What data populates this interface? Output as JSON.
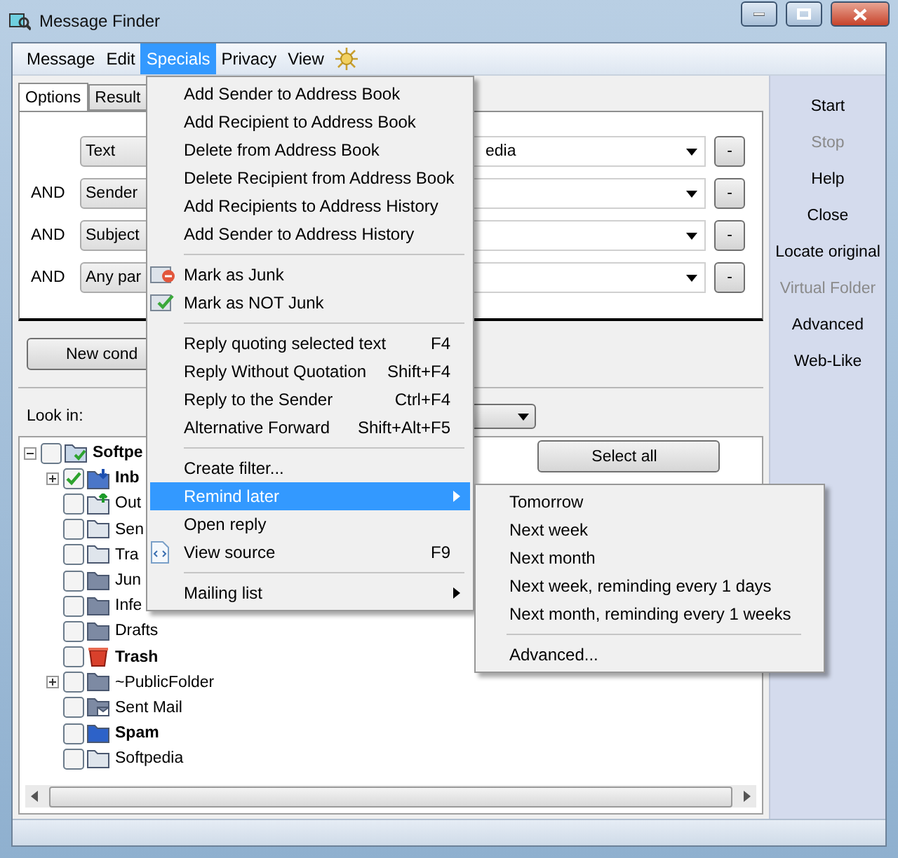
{
  "window": {
    "title": "Message Finder"
  },
  "menubar": [
    {
      "label": "Message",
      "selected": false
    },
    {
      "label": "Edit",
      "selected": false
    },
    {
      "label": "Specials",
      "selected": true
    },
    {
      "label": "Privacy",
      "selected": false
    },
    {
      "label": "View",
      "selected": false
    }
  ],
  "tabs": [
    {
      "label": "Options",
      "selected": true
    },
    {
      "label": "Result",
      "selected": false
    }
  ],
  "conditions": [
    {
      "field": "Text",
      "value": "edia",
      "button": "-"
    },
    {
      "connector": "AND",
      "field": "Sender",
      "button": "-"
    },
    {
      "connector": "AND",
      "field": "Subject",
      "button": "-"
    },
    {
      "connector": "AND",
      "field": "Any par",
      "button": "-"
    }
  ],
  "new_condition_button": "New cond",
  "look_in": {
    "label": "Look in:"
  },
  "select_all_button": "Select all",
  "folders": [
    {
      "label": "Softpe",
      "kind": "account",
      "bold": true,
      "checked": false,
      "expandable": true,
      "expanded": true,
      "children": [
        {
          "label": "Inb",
          "kind": "inbox",
          "bold": true,
          "checked": true,
          "expandable": true,
          "expanded": false
        },
        {
          "label": "Out",
          "kind": "outbox",
          "bold": false,
          "checked": false,
          "expandable": false
        },
        {
          "label": "Sen",
          "kind": "folder",
          "bold": false,
          "checked": false,
          "expandable": false
        },
        {
          "label": "Tra",
          "kind": "folder",
          "bold": false,
          "checked": false,
          "expandable": false
        },
        {
          "label": "Jun",
          "kind": "dark",
          "bold": false,
          "checked": false,
          "expandable": false
        },
        {
          "label": "Infe",
          "kind": "dark",
          "bold": false,
          "checked": false,
          "expandable": false
        },
        {
          "label": "Drafts",
          "kind": "dark",
          "bold": false,
          "checked": false,
          "expandable": false
        },
        {
          "label": "Trash",
          "kind": "trash",
          "bold": true,
          "checked": false,
          "expandable": false
        },
        {
          "label": "~PublicFolder",
          "kind": "dark",
          "bold": false,
          "checked": false,
          "expandable": true,
          "expanded": false
        },
        {
          "label": "Sent Mail",
          "kind": "sent",
          "bold": false,
          "checked": false,
          "expandable": false
        },
        {
          "label": "Spam",
          "kind": "blue",
          "bold": true,
          "checked": false,
          "expandable": false
        },
        {
          "label": "Softpedia",
          "kind": "folder",
          "bold": false,
          "checked": false,
          "expandable": false
        }
      ]
    }
  ],
  "sidebar": [
    {
      "label": "Start",
      "disabled": false
    },
    {
      "label": "Stop",
      "disabled": true
    },
    {
      "label": "Help",
      "disabled": false
    },
    {
      "label": "Close",
      "disabled": false
    },
    {
      "label": "Locate original",
      "disabled": false
    },
    {
      "label": "Virtual Folder",
      "disabled": true
    },
    {
      "label": "Advanced",
      "disabled": false
    },
    {
      "label": "Web-Like",
      "disabled": false
    }
  ],
  "specials_menu": [
    {
      "kind": "item",
      "label": "Add Sender to Address Book",
      "selected": false
    },
    {
      "kind": "item",
      "label": "Add Recipient to Address Book",
      "selected": false
    },
    {
      "kind": "item",
      "label": "Delete from Address Book",
      "selected": false
    },
    {
      "kind": "item",
      "label": "Delete Recipient from Address Book",
      "selected": false
    },
    {
      "kind": "item",
      "label": "Add Recipients to Address History",
      "selected": false
    },
    {
      "kind": "item",
      "label": "Add Sender to Address History",
      "selected": false
    },
    {
      "kind": "separator"
    },
    {
      "kind": "junk",
      "label": "Mark as Junk",
      "selected": false
    },
    {
      "kind": "notjunk",
      "label": "Mark as NOT Junk",
      "selected": false
    },
    {
      "kind": "separator"
    },
    {
      "kind": "item",
      "label": "Reply quoting selected text",
      "shortcut": "F4",
      "selected": false
    },
    {
      "kind": "item",
      "label": "Reply Without Quotation",
      "shortcut": "Shift+F4",
      "selected": false
    },
    {
      "kind": "item",
      "label": "Reply to the Sender",
      "shortcut": "Ctrl+F4",
      "selected": false
    },
    {
      "kind": "item",
      "label": "Alternative Forward",
      "shortcut": "Shift+Alt+F5",
      "selected": false
    },
    {
      "kind": "separator"
    },
    {
      "kind": "item",
      "label": "Create filter...",
      "selected": false
    },
    {
      "kind": "item",
      "label": "Remind later",
      "submenu": true,
      "selected": true
    },
    {
      "kind": "item",
      "label": "Open reply",
      "selected": false
    },
    {
      "kind": "source",
      "label": "View source",
      "shortcut": "F9",
      "selected": false
    },
    {
      "kind": "separator"
    },
    {
      "kind": "item",
      "label": "Mailing list",
      "submenu": true,
      "selected": false
    }
  ],
  "remind_submenu": [
    {
      "kind": "item",
      "label": "Tomorrow"
    },
    {
      "kind": "item",
      "label": "Next week"
    },
    {
      "kind": "item",
      "label": "Next month"
    },
    {
      "kind": "item",
      "label": "Next week, reminding every 1 days"
    },
    {
      "kind": "item",
      "label": "Next month, reminding every 1 weeks"
    },
    {
      "kind": "separator"
    },
    {
      "kind": "item",
      "label": "Advanced..."
    }
  ]
}
